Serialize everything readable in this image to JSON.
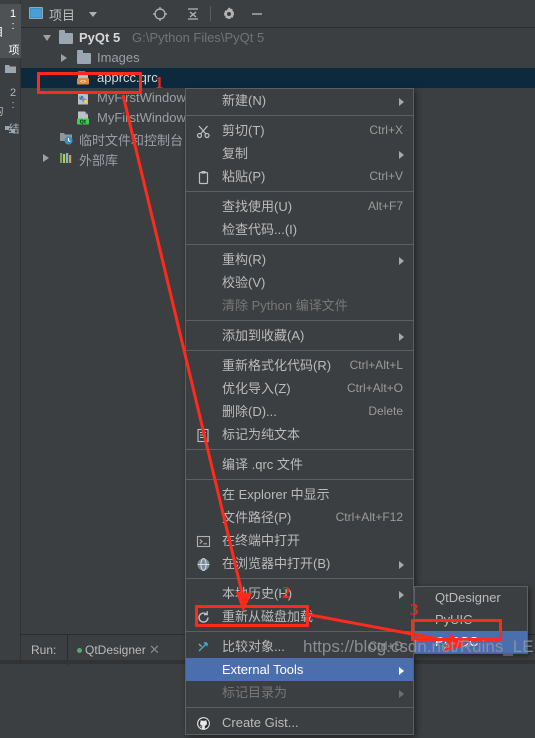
{
  "left_tabs": [
    {
      "label": "1: 项目",
      "selected": true
    },
    {
      "label": "2: 结构",
      "selected": false
    }
  ],
  "panel": {
    "title": "项目",
    "icons": [
      "locate-icon",
      "collapse-all-icon",
      "gear-icon",
      "minimize-icon"
    ]
  },
  "tree": [
    {
      "label": "PyQt 5",
      "path": "G:\\Python Files\\PyQt 5",
      "icon": "folder-icon",
      "indent": 0,
      "arrow": "open",
      "selected": false,
      "bold": true
    },
    {
      "label": "Images",
      "path": "",
      "icon": "folder-icon",
      "indent": 1,
      "arrow": "closed",
      "selected": false,
      "bold": false
    },
    {
      "label": "apprcc.qrc",
      "path": "",
      "icon": "qrc-file-icon",
      "indent": 2,
      "arrow": "",
      "selected": true,
      "bold": false
    },
    {
      "label": "MyFirstWindow.py",
      "path": "",
      "icon": "python-file-icon",
      "indent": 2,
      "arrow": "",
      "selected": false,
      "bold": false
    },
    {
      "label": "MyFirstWindow.ui",
      "path": "",
      "icon": "qt-ui-file-icon",
      "indent": 2,
      "arrow": "",
      "selected": false,
      "bold": false
    },
    {
      "label": "临时文件和控制台",
      "path": "",
      "icon": "scratches-icon",
      "indent": 1,
      "arrow": "",
      "selected": false,
      "bold": false
    },
    {
      "label": "外部库",
      "path": "",
      "icon": "external-libraries-icon",
      "indent": 0,
      "arrow": "closed",
      "selected": false,
      "bold": false
    }
  ],
  "context_menu": [
    {
      "label": "新建(N)",
      "accel": "",
      "submenu": true,
      "icon": "",
      "state": "normal"
    },
    {
      "sep": true
    },
    {
      "label": "剪切(T)",
      "accel": "Ctrl+X",
      "submenu": false,
      "icon": "scissors-icon",
      "state": "normal"
    },
    {
      "label": "复制",
      "accel": "",
      "submenu": true,
      "icon": "",
      "state": "normal"
    },
    {
      "label": "粘贴(P)",
      "accel": "Ctrl+V",
      "submenu": false,
      "icon": "clipboard-icon",
      "state": "normal"
    },
    {
      "sep": true
    },
    {
      "label": "查找使用(U)",
      "accel": "Alt+F7",
      "submenu": false,
      "icon": "",
      "state": "normal"
    },
    {
      "label": "检查代码...(I)",
      "accel": "",
      "submenu": false,
      "icon": "",
      "state": "normal"
    },
    {
      "sep": true
    },
    {
      "label": "重构(R)",
      "accel": "",
      "submenu": true,
      "icon": "",
      "state": "normal"
    },
    {
      "label": "校验(V)",
      "accel": "",
      "submenu": false,
      "icon": "",
      "state": "normal"
    },
    {
      "label": "清除 Python 编译文件",
      "accel": "",
      "submenu": false,
      "icon": "",
      "state": "disabled"
    },
    {
      "sep": true
    },
    {
      "label": "添加到收藏(A)",
      "accel": "",
      "submenu": true,
      "icon": "",
      "state": "normal"
    },
    {
      "sep": true
    },
    {
      "label": "重新格式化代码(R)",
      "accel": "Ctrl+Alt+L",
      "submenu": false,
      "icon": "",
      "state": "normal"
    },
    {
      "label": "优化导入(Z)",
      "accel": "Ctrl+Alt+O",
      "submenu": false,
      "icon": "",
      "state": "normal"
    },
    {
      "label": "删除(D)...",
      "accel": "Delete",
      "submenu": false,
      "icon": "",
      "state": "normal"
    },
    {
      "label": "标记为纯文本",
      "accel": "",
      "submenu": false,
      "icon": "plain-text-icon",
      "state": "normal"
    },
    {
      "sep": true
    },
    {
      "label": "编译 .qrc 文件",
      "accel": "",
      "submenu": false,
      "icon": "",
      "state": "normal"
    },
    {
      "sep": true
    },
    {
      "label": "在 Explorer 中显示",
      "accel": "",
      "submenu": false,
      "icon": "",
      "state": "normal"
    },
    {
      "label": "文件路径(P)",
      "accel": "Ctrl+Alt+F12",
      "submenu": false,
      "icon": "",
      "state": "normal"
    },
    {
      "label": "在终端中打开",
      "accel": "",
      "submenu": false,
      "icon": "terminal-icon",
      "state": "normal"
    },
    {
      "label": "在浏览器中打开(B)",
      "accel": "",
      "submenu": true,
      "icon": "globe-icon",
      "state": "normal"
    },
    {
      "sep": true
    },
    {
      "label": "本地历史(H)",
      "accel": "",
      "submenu": true,
      "icon": "",
      "state": "normal"
    },
    {
      "label": "重新从磁盘加载",
      "accel": "",
      "submenu": false,
      "icon": "refresh-icon",
      "state": "normal"
    },
    {
      "sep": true
    },
    {
      "label": "比较对象...",
      "accel": "Ctrl+D",
      "submenu": false,
      "icon": "compare-icon",
      "state": "normal"
    },
    {
      "label": "External Tools",
      "accel": "",
      "submenu": true,
      "icon": "",
      "state": "highlighted"
    },
    {
      "label": "标记目录为",
      "accel": "",
      "submenu": true,
      "icon": "",
      "state": "disabled"
    },
    {
      "sep": true
    },
    {
      "label": "Create Gist...",
      "accel": "",
      "submenu": false,
      "icon": "github-icon",
      "state": "normal"
    }
  ],
  "submenu": {
    "items": [
      {
        "label": "QtDesigner",
        "state": "normal"
      },
      {
        "label": "PyUIC",
        "state": "normal"
      },
      {
        "label": "PyRCC",
        "state": "highlighted"
      }
    ]
  },
  "run_bar": {
    "label": "Run:",
    "tab": "QtDesigner",
    "close": "✕"
  },
  "annotations": {
    "step1": "1",
    "step2": "2",
    "step3": "3",
    "watermark": "https://blog.csdn.net/Ruins_LEE",
    "accent_red": "#ff2a1c",
    "highlight_blue": "#4b6eaf"
  }
}
